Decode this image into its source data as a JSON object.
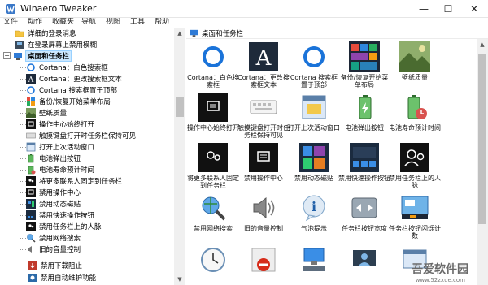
{
  "window": {
    "title": "Winaero Tweaker",
    "minimize": "—",
    "maximize": "☐",
    "close": "✕"
  },
  "menu": [
    "文件",
    "动作",
    "收藏夹",
    "导航",
    "视图",
    "工具",
    "帮助"
  ],
  "tree": {
    "items": [
      {
        "label": "详细的登录消息",
        "icon": "folder-icon"
      },
      {
        "label": "在登录屏幕上禁用模糊",
        "icon": "lock-screen-icon"
      },
      {
        "label": "桌面和任务栏",
        "icon": "desktop-icon",
        "category": true,
        "selected": true
      },
      {
        "label": "Cortana：白色搜索框",
        "icon": "cortana-ring-icon"
      },
      {
        "label": "Cortana：更改搜索框文本",
        "icon": "text-a-icon"
      },
      {
        "label": "Cortana 搜索框置于顶部",
        "icon": "cortana-ring-icon"
      },
      {
        "label": "备份/恢复开始菜单布局",
        "icon": "start-tiles-icon"
      },
      {
        "label": "壁纸质量",
        "icon": "wallpaper-icon"
      },
      {
        "label": "操作中心始终打开",
        "icon": "action-center-icon"
      },
      {
        "label": "触摸键盘打开时任务栏保持可见",
        "icon": "keyboard-icon"
      },
      {
        "label": "打开上次活动窗口",
        "icon": "window-icon"
      },
      {
        "label": "电池弹出按钮",
        "icon": "battery-icon"
      },
      {
        "label": "电池寿命预计时间",
        "icon": "battery-time-icon"
      },
      {
        "label": "将更多联系人固定到任务栏",
        "icon": "people-icon"
      },
      {
        "label": "禁用操作中心",
        "icon": "action-center-icon"
      },
      {
        "label": "禁用动态磁贴",
        "icon": "live-tiles-icon"
      },
      {
        "label": "禁用快速操作按钮",
        "icon": "quick-actions-icon"
      },
      {
        "label": "禁用任务栏上的人脉",
        "icon": "people-icon"
      },
      {
        "label": "禁用网络搜索",
        "icon": "globe-search-icon"
      },
      {
        "label": "旧的音量控制",
        "icon": "speaker-icon"
      },
      {
        "label": "禁用下载阻止",
        "icon": "download-icon"
      },
      {
        "label": "禁用自动维护功能",
        "icon": "maintenance-icon"
      }
    ]
  },
  "panel": {
    "title": "桌面和任务栏",
    "tiles": [
      {
        "caption": "Cortana：白色搜索框",
        "icon": "cortana-ring-icon"
      },
      {
        "caption": "Cortana：更改搜索框文本",
        "icon": "text-a-icon"
      },
      {
        "caption": "Cortana 搜索框置于顶部",
        "icon": "cortana-ring-icon"
      },
      {
        "caption": "备份/恢复开始菜单布局",
        "icon": "start-tiles-icon"
      },
      {
        "caption": "壁纸质量",
        "icon": "wallpaper-icon"
      },
      {
        "caption": "操作中心始终打开",
        "icon": "action-center-icon"
      },
      {
        "caption": "触摸键盘打开时任务栏保持可见",
        "icon": "keyboard-icon"
      },
      {
        "caption": "打开上次活动窗口",
        "icon": "window-icon"
      },
      {
        "caption": "电池弹出按钮",
        "icon": "battery-icon"
      },
      {
        "caption": "电池寿命预计时间",
        "icon": "battery-time-icon"
      },
      {
        "caption": "将更多联系人固定到任务栏",
        "icon": "people-icon"
      },
      {
        "caption": "禁用操作中心",
        "icon": "action-center-icon"
      },
      {
        "caption": "禁用动态磁贴",
        "icon": "live-tiles-icon"
      },
      {
        "caption": "禁用快速操作按钮",
        "icon": "quick-actions-icon"
      },
      {
        "caption": "禁用任务栏上的人脉",
        "icon": "people-icon"
      },
      {
        "caption": "禁用网络搜索",
        "icon": "globe-search-icon"
      },
      {
        "caption": "旧的音量控制",
        "icon": "speaker-icon"
      },
      {
        "caption": "气泡提示",
        "icon": "info-icon"
      },
      {
        "caption": "任务栏按钮宽度",
        "icon": "taskbar-width-icon"
      },
      {
        "caption": "任务栏按钮闪烁计数",
        "icon": "taskbar-flash-icon"
      },
      {
        "caption": "",
        "icon": "clock-icon"
      },
      {
        "caption": "",
        "icon": "no-entry-icon"
      },
      {
        "caption": "",
        "icon": "network-icon"
      },
      {
        "caption": "",
        "icon": "user-pc-icon"
      },
      {
        "caption": "",
        "icon": "window-icon"
      }
    ]
  },
  "watermark": {
    "text": "吾爱软件园",
    "url": "www.52zxue.com"
  }
}
